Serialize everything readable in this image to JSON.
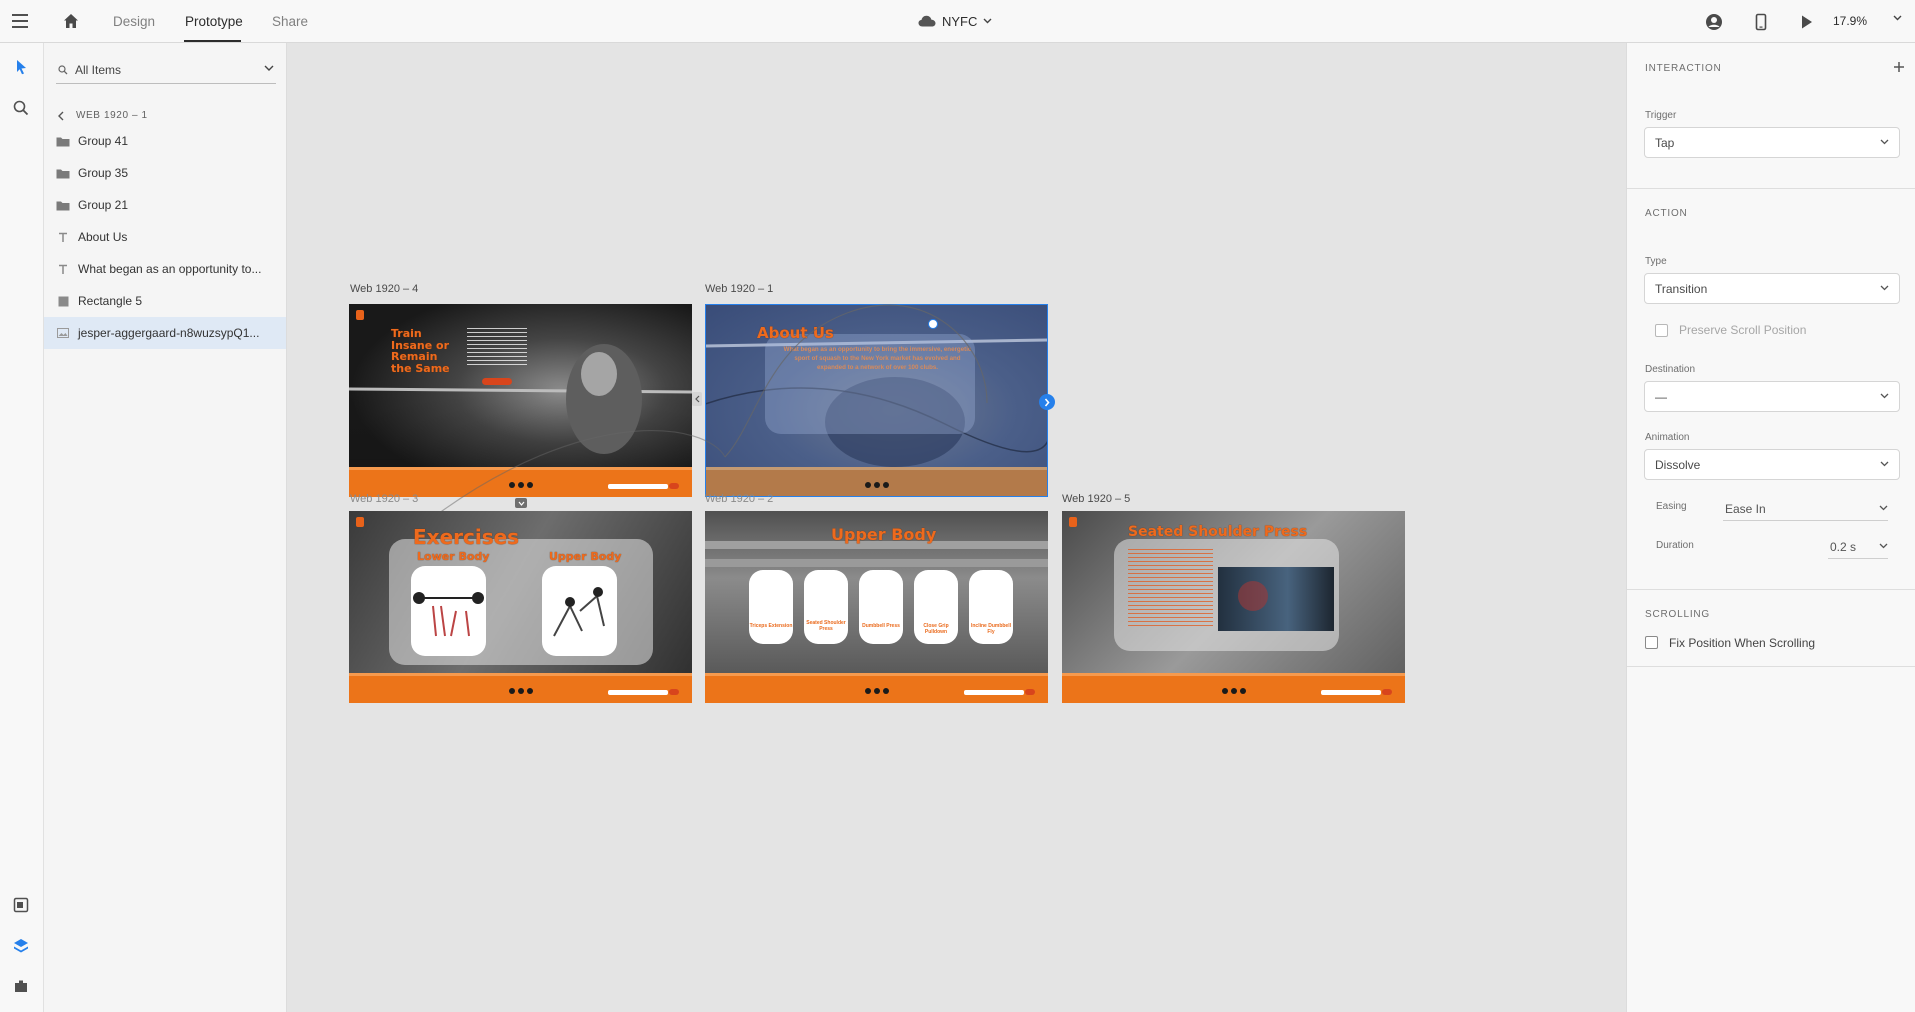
{
  "topbar": {
    "tabs": [
      {
        "label": "Design"
      },
      {
        "label": "Prototype"
      },
      {
        "label": "Share"
      }
    ],
    "document_title": "NYFC",
    "zoom": "17.9%"
  },
  "layers": {
    "filter_label": "All Items",
    "breadcrumb": "WEB 1920 – 1",
    "items": [
      {
        "type": "folder",
        "label": "Group 41"
      },
      {
        "type": "folder",
        "label": "Group 35"
      },
      {
        "type": "folder",
        "label": "Group 21"
      },
      {
        "type": "text",
        "label": "About Us"
      },
      {
        "type": "text",
        "label": "What began as an opportunity to..."
      },
      {
        "type": "rectangle",
        "label": "Rectangle 5"
      },
      {
        "type": "image",
        "label": "jesper-aggergaard-n8wuzsypQ1..."
      }
    ]
  },
  "canvas": {
    "artboards": [
      {
        "label": "Web 1920 – 4",
        "heading": "Train Insane or Remain the Same"
      },
      {
        "label": "Web 1920 – 1",
        "heading": "About Us"
      },
      {
        "label": "Web 1920 – 3",
        "heading": "Exercises",
        "sub_left": "Lower Body",
        "sub_right": "Upper Body"
      },
      {
        "label": "Web 1920 – 2",
        "heading": "Upper Body",
        "cards": [
          "Triceps Extension",
          "Seated Shoulder Press",
          "Dumbbell Press",
          "Close Grip Pulldown",
          "Incline Dumbbell Fly"
        ]
      },
      {
        "label": "Web 1920 – 5",
        "heading": "Seated Shoulder Press"
      }
    ],
    "about_body": "What began as an opportunity to bring the immersive, energetic sport of squash to the New York market has evolved and expanded to a network of over 100 clubs."
  },
  "interaction": {
    "title": "INTERACTION",
    "trigger_label": "Trigger",
    "trigger_value": "Tap",
    "action_title": "ACTION",
    "type_label": "Type",
    "type_value": "Transition",
    "preserve_scroll": "Preserve Scroll Position",
    "destination_label": "Destination",
    "destination_value": "—",
    "animation_label": "Animation",
    "animation_value": "Dissolve",
    "easing_label": "Easing",
    "easing_value": "Ease In",
    "duration_label": "Duration",
    "duration_value": "0.2 s",
    "scrolling_title": "SCROLLING",
    "fix_position": "Fix Position When Scrolling"
  },
  "colors": {
    "accent": "#2680eb",
    "brand_orange": "#ec7419",
    "selection_fill": "#4a6fb5"
  }
}
